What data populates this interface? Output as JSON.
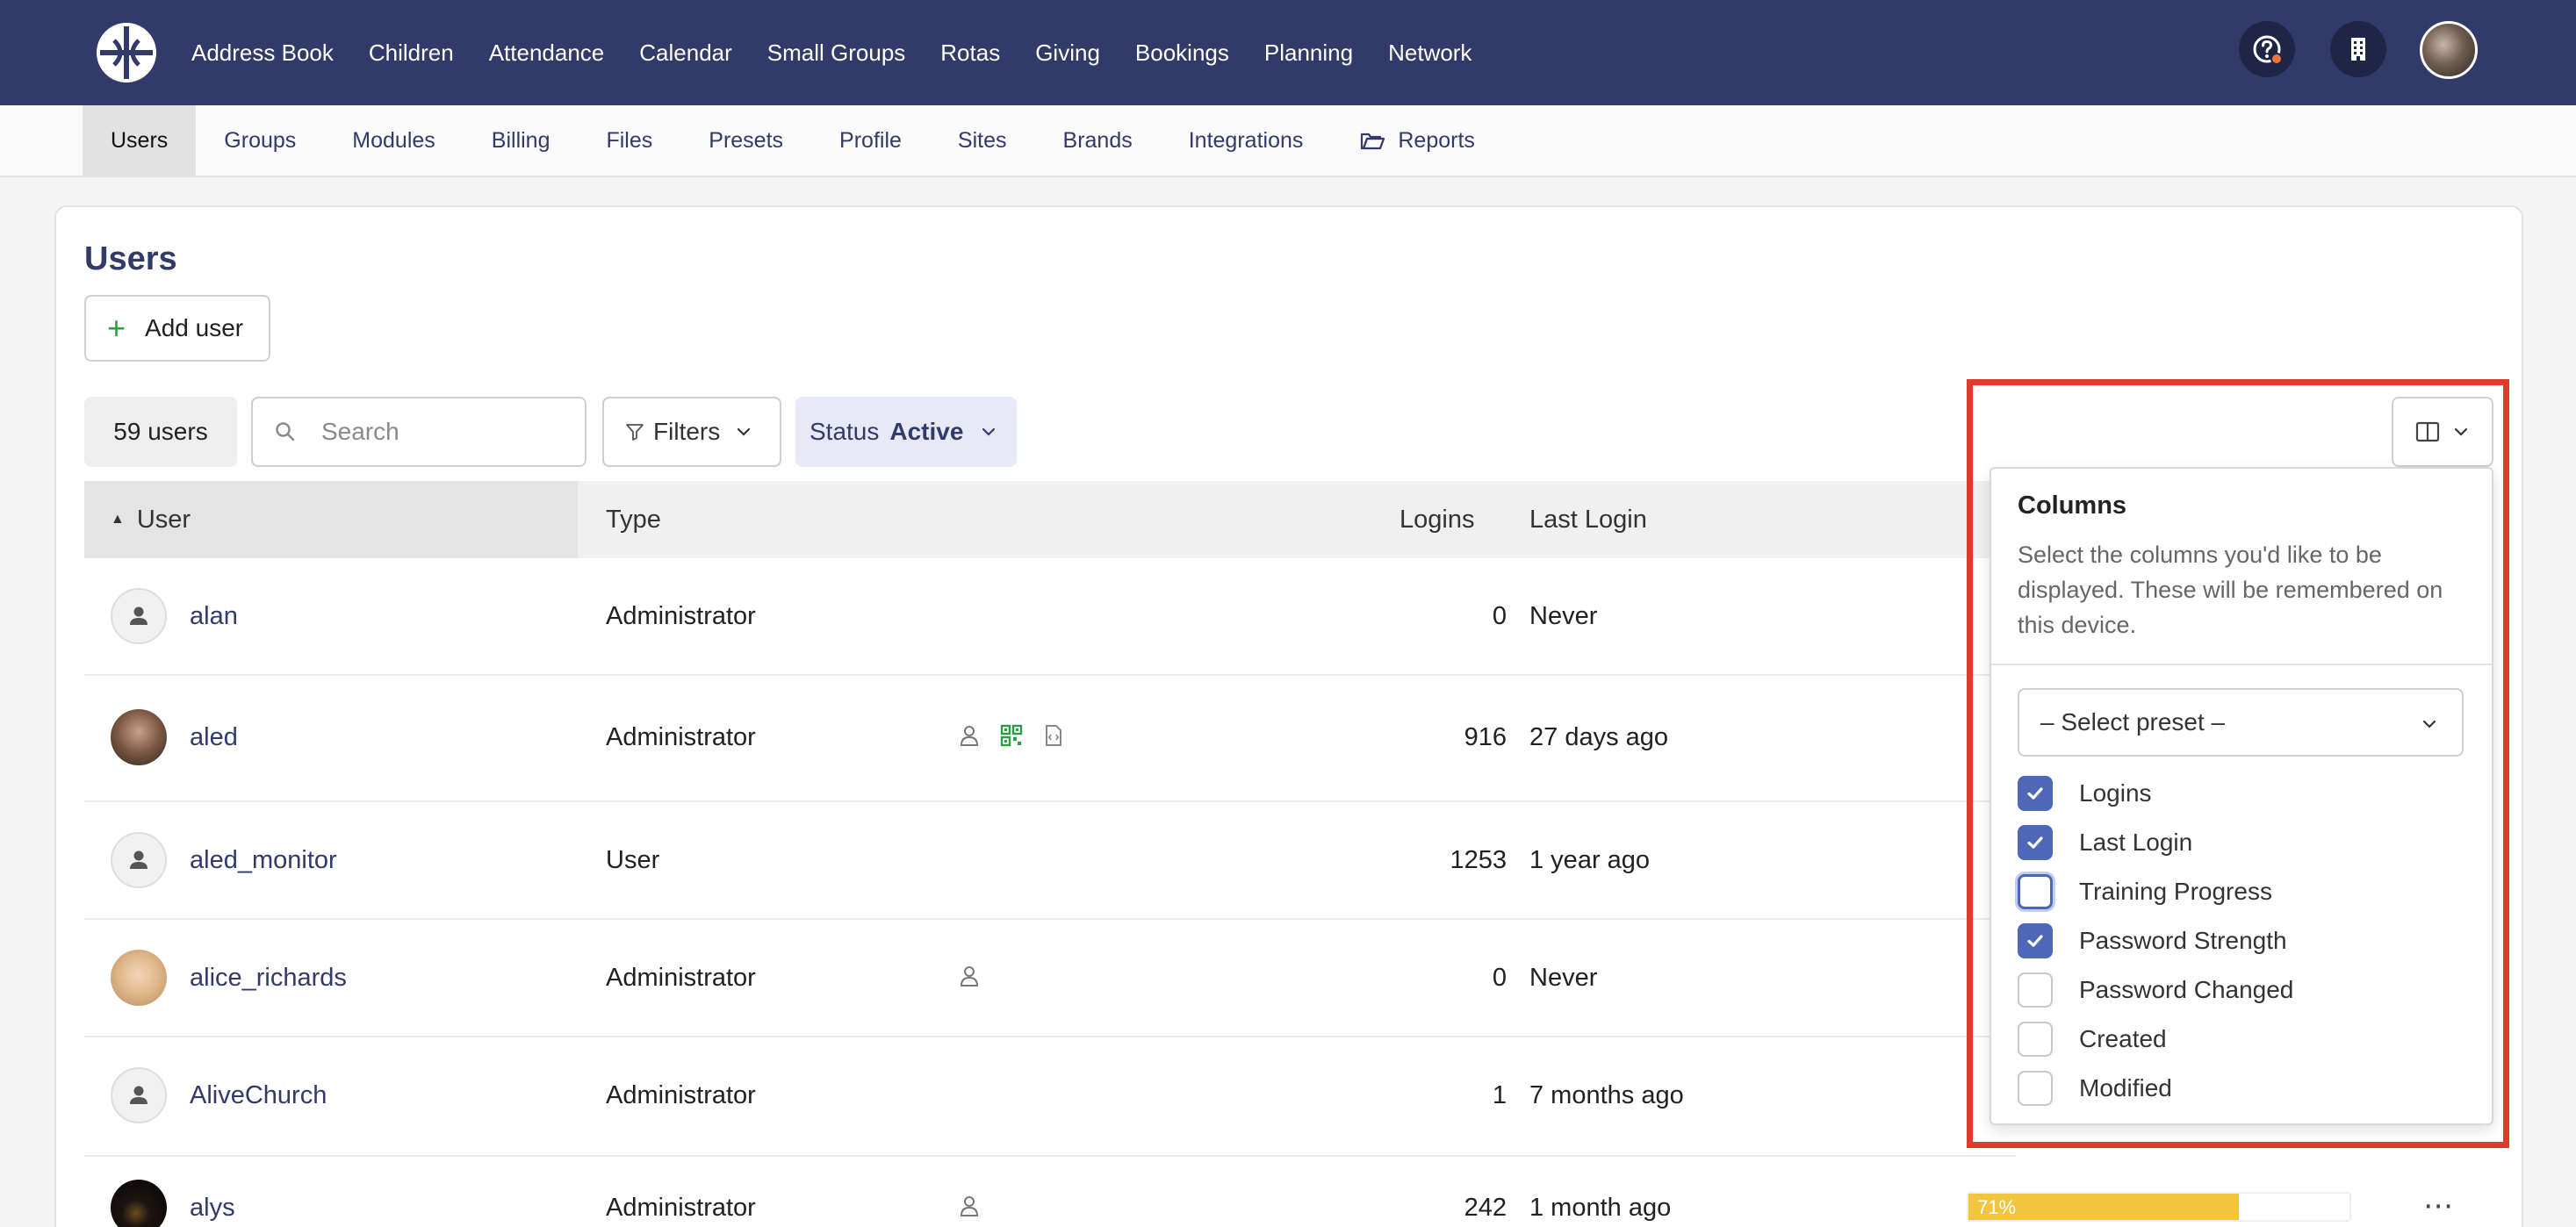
{
  "top_nav": {
    "items": [
      "Address Book",
      "Children",
      "Attendance",
      "Calendar",
      "Small Groups",
      "Rotas",
      "Giving",
      "Bookings",
      "Planning",
      "Network"
    ]
  },
  "sub_nav": {
    "items": [
      "Users",
      "Groups",
      "Modules",
      "Billing",
      "Files",
      "Presets",
      "Profile",
      "Sites",
      "Brands",
      "Integrations",
      "Reports"
    ],
    "active": "Users"
  },
  "page": {
    "title": "Users",
    "add_user_label": "Add user"
  },
  "toolbar": {
    "user_count": "59 users",
    "search_placeholder": "Search",
    "filters_label": "Filters",
    "status_label": "Status",
    "status_value": "Active"
  },
  "table": {
    "headers": {
      "user": "User",
      "type": "Type",
      "logins": "Logins",
      "last_login": "Last Login"
    },
    "rows": [
      {
        "name": "alan",
        "type": "Administrator",
        "logins": "0",
        "last_login": "Never"
      },
      {
        "name": "aled",
        "type": "Administrator",
        "logins": "916",
        "last_login": "27 days ago"
      },
      {
        "name": "aled_monitor",
        "type": "User",
        "logins": "1253",
        "last_login": "1 year ago"
      },
      {
        "name": "alice_richards",
        "type": "Administrator",
        "logins": "0",
        "last_login": "Never"
      },
      {
        "name": "AliveChurch",
        "type": "Administrator",
        "logins": "1",
        "last_login": "7 months ago"
      },
      {
        "name": "alys",
        "type": "Administrator",
        "logins": "242",
        "last_login": "1 month ago",
        "password_strength": "71%",
        "password_strength_fraction": 0.71
      }
    ]
  },
  "columns_menu": {
    "title": "Columns",
    "description": "Select the columns you'd like to be displayed. These will be remembered on this device.",
    "preset_placeholder": "– Select preset –",
    "options": [
      {
        "label": "Logins",
        "checked": true
      },
      {
        "label": "Last Login",
        "checked": true
      },
      {
        "label": "Training Progress",
        "checked": false
      },
      {
        "label": "Password Strength",
        "checked": true
      },
      {
        "label": "Password Changed",
        "checked": false
      },
      {
        "label": "Created",
        "checked": false
      },
      {
        "label": "Modified",
        "checked": false
      }
    ]
  },
  "colors": {
    "brand": "#323a69",
    "accent_checkbox": "#4e67b7",
    "highlight": "#e2392d",
    "password_bar": "#f2c53d",
    "add_icon": "#2e9e44"
  }
}
